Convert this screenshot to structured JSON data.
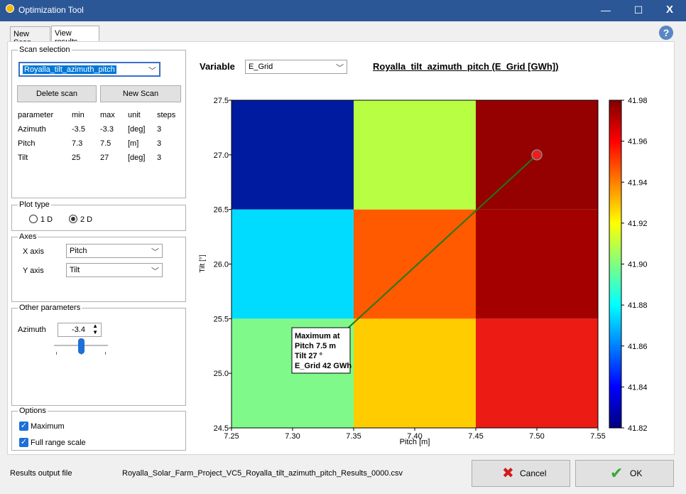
{
  "window": {
    "title": "Optimization Tool",
    "minimize": "—",
    "maximize": "☐",
    "close": "X"
  },
  "tabs": [
    {
      "label": "New Scan"
    },
    {
      "label": "View results"
    }
  ],
  "help": "?",
  "scan_selection": {
    "legend": "Scan selection",
    "selected": "Royalla_tilt_azimuth_pitch",
    "delete_label": "Delete scan",
    "new_label": "New Scan",
    "headers": [
      "parameter",
      "min",
      "max",
      "unit",
      "steps"
    ],
    "rows": [
      [
        "Azimuth",
        "-3.5",
        "-3.3",
        "[deg]",
        "3"
      ],
      [
        "Pitch",
        "7.3",
        "7.5",
        "[m]",
        "3"
      ],
      [
        "Tilt",
        "25",
        "27",
        "[deg]",
        "3"
      ]
    ]
  },
  "plot_type": {
    "legend": "Plot type",
    "opt1": "1 D",
    "opt2": "2 D",
    "selected": "2 D"
  },
  "axes": {
    "legend": "Axes",
    "x_label": "X axis",
    "x_value": "Pitch",
    "y_label": "Y axis",
    "y_value": "Tilt"
  },
  "other_params": {
    "legend": "Other parameters",
    "label": "Azimuth",
    "value": "-3.4"
  },
  "options": {
    "legend": "Options",
    "maximum": "Maximum",
    "full_range": "Full range scale",
    "maximum_checked": true,
    "full_range_checked": true
  },
  "variable": {
    "label": "Variable",
    "value": "E_Grid"
  },
  "plot_title": "Royalla_tilt_azimuth_pitch (E_Grid [GWh])",
  "chart_data": {
    "type": "heatmap",
    "xlabel": "Pitch [m]",
    "ylabel": "Tilt [°]",
    "xlim": [
      7.25,
      7.55
    ],
    "ylim": [
      24.5,
      27.5
    ],
    "x_ticks": [
      "7.25",
      "7.30",
      "7.35",
      "7.40",
      "7.45",
      "7.50",
      "7.55"
    ],
    "y_ticks": [
      "24.5",
      "25.0",
      "25.5",
      "26.0",
      "26.5",
      "27.0",
      "27.5"
    ],
    "x_centers": [
      7.3,
      7.4,
      7.5
    ],
    "y_centers": [
      25,
      26,
      27
    ],
    "x_edges": [
      7.25,
      7.35,
      7.45,
      7.55
    ],
    "y_edges": [
      24.5,
      25.5,
      26.5,
      27.5
    ],
    "cells": [
      {
        "x": 7.3,
        "y": 25,
        "value": 41.885,
        "color": "#7ffa8a"
      },
      {
        "x": 7.4,
        "y": 25,
        "value": 41.925,
        "color": "#ffcc00"
      },
      {
        "x": 7.5,
        "y": 25,
        "value": 41.965,
        "color": "#ec1b14"
      },
      {
        "x": 7.3,
        "y": 26,
        "value": 41.86,
        "color": "#00dcff"
      },
      {
        "x": 7.4,
        "y": 26,
        "value": 41.945,
        "color": "#ff5a00"
      },
      {
        "x": 7.5,
        "y": 26,
        "value": 41.975,
        "color": "#a50000"
      },
      {
        "x": 7.3,
        "y": 27,
        "value": 41.82,
        "color": "#001ba0"
      },
      {
        "x": 7.4,
        "y": 27,
        "value": 41.91,
        "color": "#b8fe42"
      },
      {
        "x": 7.5,
        "y": 27,
        "value": 41.98,
        "color": "#950000"
      }
    ],
    "colorbar": {
      "min": 41.82,
      "max": 41.98,
      "ticks": [
        "41.98",
        "41.96",
        "41.94",
        "41.92",
        "41.90",
        "41.88",
        "41.86",
        "41.84",
        "41.82"
      ],
      "stops": [
        "#00007f",
        "#0000ff",
        "#0080ff",
        "#00ffff",
        "#80ff80",
        "#ffff00",
        "#ff8000",
        "#ff0000",
        "#7f0000"
      ]
    },
    "maximum": {
      "x": 7.5,
      "y": 27,
      "annotation": [
        "Maximum at",
        "Pitch 7.5 m",
        "Tilt 27 °",
        "E_Grid 42 GWh"
      ],
      "label_anchor": {
        "x": 7.343,
        "y": 25.39
      }
    }
  },
  "footer": {
    "output_label": "Results output file",
    "output_file": "Royalla_Solar_Farm_Project_VC5_Royalla_tilt_azimuth_pitch_Results_0000.csv",
    "cancel": "Cancel",
    "ok": "OK"
  }
}
